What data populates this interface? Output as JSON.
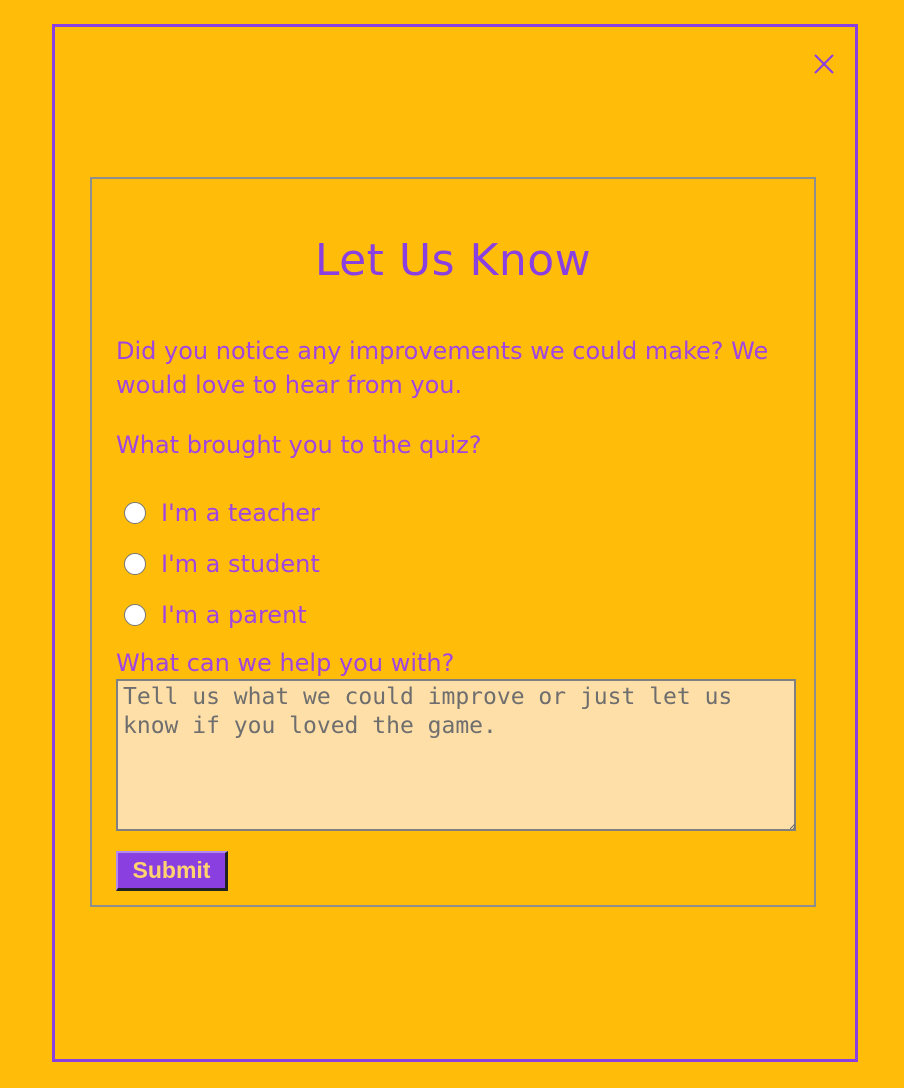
{
  "modal": {
    "close_icon": "close-icon"
  },
  "form": {
    "title": "Let Us Know",
    "intro": "Did you notice any improvements we could make? We would love to hear from you.",
    "question": "What brought you to the quiz?",
    "options": [
      {
        "label": "I'm a teacher",
        "selected": false
      },
      {
        "label": "I'm a student",
        "selected": false
      },
      {
        "label": "I'm a parent",
        "selected": false
      }
    ],
    "help_label": "What can we help you with?",
    "textarea_placeholder": "Tell us what we could improve or just let us know if you loved the game.",
    "textarea_value": "",
    "submit_label": "Submit"
  },
  "colors": {
    "background": "#FFBD0A",
    "accent": "#8A3FE0",
    "text": "#A045E0",
    "textarea_bg": "#FFDFA8"
  }
}
